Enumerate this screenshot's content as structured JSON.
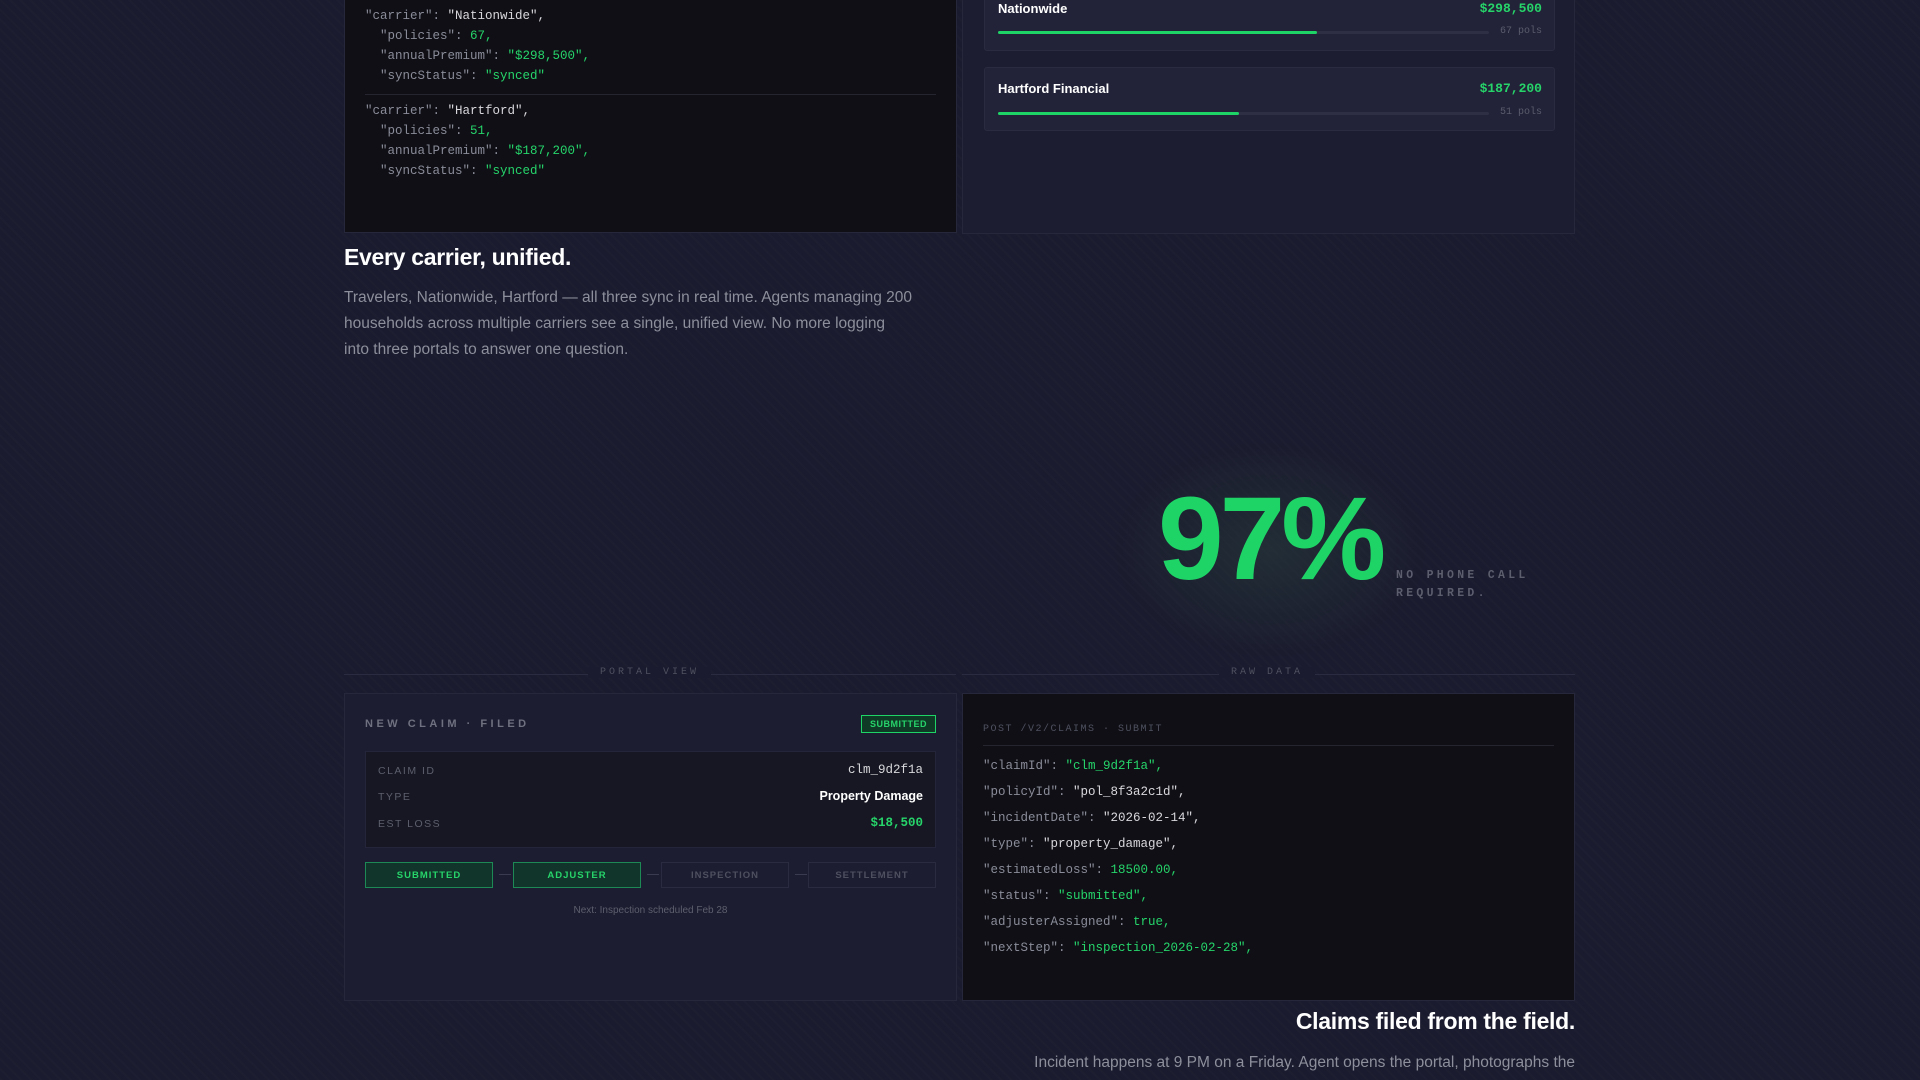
{
  "carrier_code": {
    "blocks": [
      {
        "carrier": "\"Nationwide\"",
        "policies": "67",
        "annualPremium": "\"$298,500\"",
        "syncStatus": "\"synced\""
      },
      {
        "carrier": "\"Hartford\"",
        "policies": "51",
        "annualPremium": "\"$187,200\"",
        "syncStatus": "\"synced\""
      }
    ]
  },
  "carrier_cards": [
    {
      "name": "Nationwide",
      "amount": "$298,500",
      "pols": "67 pols",
      "fill_fraction": 0.65
    },
    {
      "name": "Hartford Financial",
      "amount": "$187,200",
      "pols": "51 pols",
      "fill_fraction": 0.49
    }
  ],
  "unified": {
    "heading": "Every carrier, unified.",
    "body": "Travelers, Nationwide, Hartford — all three sync in real time. Agents managing 200 households across multiple carriers see a single, unified view. No more logging into three portals to answer one question."
  },
  "stat": {
    "value": "97%",
    "label": "NO PHONE CALL REQUIRED."
  },
  "dividers": {
    "left": "PORTAL VIEW",
    "right": "RAW DATA"
  },
  "portal": {
    "title": "NEW CLAIM · FILED",
    "badge": "SUBMITTED",
    "rows": [
      {
        "key": "CLAIM ID",
        "value": "clm_9d2f1a"
      },
      {
        "key": "TYPE",
        "value": "Property Damage"
      },
      {
        "key": "EST LOSS",
        "value": "$18,500"
      }
    ],
    "steps": [
      {
        "label": "SUBMITTED",
        "active": true
      },
      {
        "label": "ADJUSTER",
        "active": true
      },
      {
        "label": "INSPECTION",
        "active": false
      },
      {
        "label": "SETTLEMENT",
        "active": false
      }
    ],
    "next_note": "Next: Inspection scheduled Feb 28"
  },
  "raw": {
    "header": "POST /V2/CLAIMS · SUBMIT",
    "lines": [
      {
        "key": "\"claimId\"",
        "value": "\"clm_9d2f1a\",",
        "color": "green"
      },
      {
        "key": "\"policyId\"",
        "value": "\"pol_8f3a2c1d\",",
        "color": "white"
      },
      {
        "key": "\"incidentDate\"",
        "value": "\"2026-02-14\",",
        "color": "white"
      },
      {
        "key": "\"type\"",
        "value": "\"property_damage\",",
        "color": "white"
      },
      {
        "key": "\"estimatedLoss\"",
        "value": "18500.00,",
        "color": "green"
      },
      {
        "key": "\"status\"",
        "value": "\"submitted\",",
        "color": "green"
      },
      {
        "key": "\"adjusterAssigned\"",
        "value": "true,",
        "color": "green"
      },
      {
        "key": "\"nextStep\"",
        "value": "\"inspection_2026-02-28\",",
        "color": "green"
      }
    ]
  },
  "claims_section": {
    "heading": "Claims filed from the field.",
    "body": "Incident happens at 9 PM on a Friday. Agent opens the portal, photographs the"
  },
  "colors": {
    "background": "#1a1b2e",
    "accent": "#1fd467",
    "panel_dark": "#0f0f15"
  }
}
